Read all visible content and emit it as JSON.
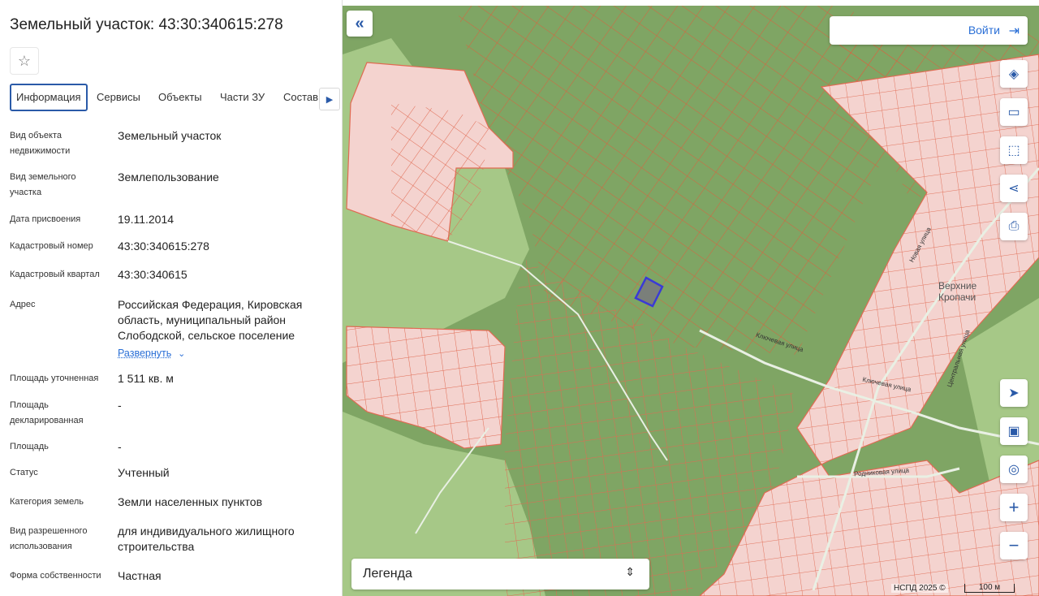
{
  "panel": {
    "title": "Земельный участок: 43:30:340615:278",
    "tabs": [
      "Информация",
      "Сервисы",
      "Объекты",
      "Части ЗУ",
      "Состав"
    ],
    "fields": [
      {
        "label": "Вид объекта недвижимости",
        "value": "Земельный участок"
      },
      {
        "label": "Вид земельного участка",
        "value": "Землепользование"
      },
      {
        "label": "Дата присвоения",
        "value": "19.11.2014"
      },
      {
        "label": "Кадастровый номер",
        "value": "43:30:340615:278"
      },
      {
        "label": "Кадастровый квартал",
        "value": "43:30:340615"
      },
      {
        "label": "Адрес",
        "value": "Российская Федерация, Кировская область, муниципальный район Слободской, сельское поселение"
      },
      {
        "label": "Площадь уточненная",
        "value": "1 511 кв. м"
      },
      {
        "label": "Площадь декларированная",
        "value": "-"
      },
      {
        "label": "Площадь",
        "value": "-"
      },
      {
        "label": "Статус",
        "value": "Учтенный"
      },
      {
        "label": "Категория земель",
        "value": "Земли населенных пунктов"
      },
      {
        "label": "Вид разрешенного использования",
        "value": "для индивидуального жилищного строительства"
      },
      {
        "label": "Форма собственности",
        "value": "Частная"
      }
    ],
    "expand_label": "Развернуть"
  },
  "map": {
    "login_label": "Войти",
    "legend_label": "Легенда",
    "copyright": "НСПД 2025 ©",
    "scale_label": "100 м",
    "place_name": "Верхние Кропачи",
    "streets": [
      "Новая улица",
      "Ключевая улица",
      "Центральная улица",
      "Родниковая улица",
      "Ключевая улица"
    ],
    "tools": [
      "layers-icon",
      "ruler-icon",
      "select-area-icon",
      "share-icon",
      "print-icon",
      "locate-icon",
      "minimap-icon",
      "geo-icon",
      "zoom-in-icon",
      "zoom-out-icon"
    ],
    "colors": {
      "green": "#7fa564",
      "light_green": "#a8cb8a",
      "parcel_line": "#e06a52",
      "pink": "#f4d3cf",
      "selected": "#3a3ad6"
    }
  }
}
